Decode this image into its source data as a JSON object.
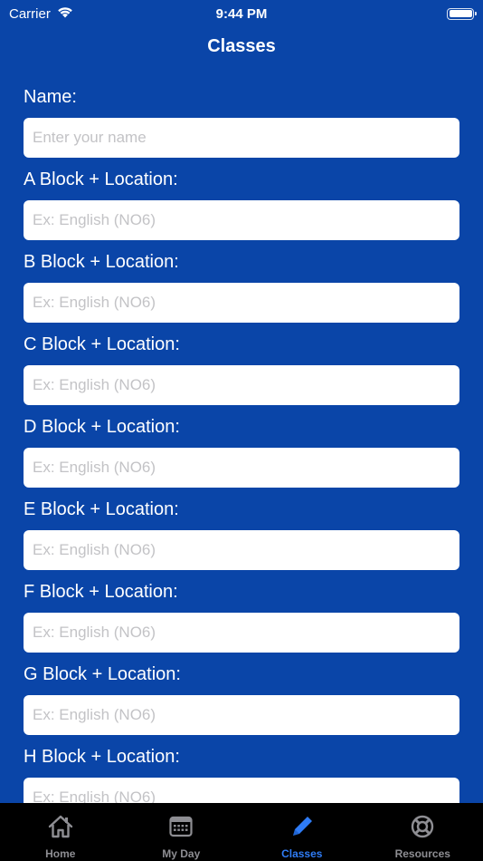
{
  "status_bar": {
    "carrier": "Carrier",
    "time": "9:44 PM"
  },
  "nav": {
    "title": "Classes"
  },
  "form": {
    "name_label": "Name:",
    "name_placeholder": "Enter your name",
    "fields": [
      {
        "label": "A Block + Location:",
        "placeholder": "Ex: English (NO6)"
      },
      {
        "label": "B Block + Location:",
        "placeholder": "Ex: English (NO6)"
      },
      {
        "label": "C Block + Location:",
        "placeholder": "Ex: English (NO6)"
      },
      {
        "label": "D Block + Location:",
        "placeholder": "Ex: English (NO6)"
      },
      {
        "label": "E Block + Location:",
        "placeholder": "Ex: English (NO6)"
      },
      {
        "label": "F Block + Location:",
        "placeholder": "Ex: English (NO6)"
      },
      {
        "label": "G Block + Location:",
        "placeholder": "Ex: English (NO6)"
      },
      {
        "label": "H Block + Location:",
        "placeholder": "Ex: English (NO6)"
      }
    ]
  },
  "tab_bar": {
    "items": [
      {
        "label": "Home",
        "icon": "house-icon",
        "active": false
      },
      {
        "label": "My Day",
        "icon": "calendar-icon",
        "active": false
      },
      {
        "label": "Classes",
        "icon": "pencil-icon",
        "active": true
      },
      {
        "label": "Resources",
        "icon": "lifebuoy-icon",
        "active": false
      }
    ]
  },
  "colors": {
    "background": "#0a45a8",
    "tab_active": "#2f7cf6",
    "tab_inactive": "#8e8e93"
  }
}
